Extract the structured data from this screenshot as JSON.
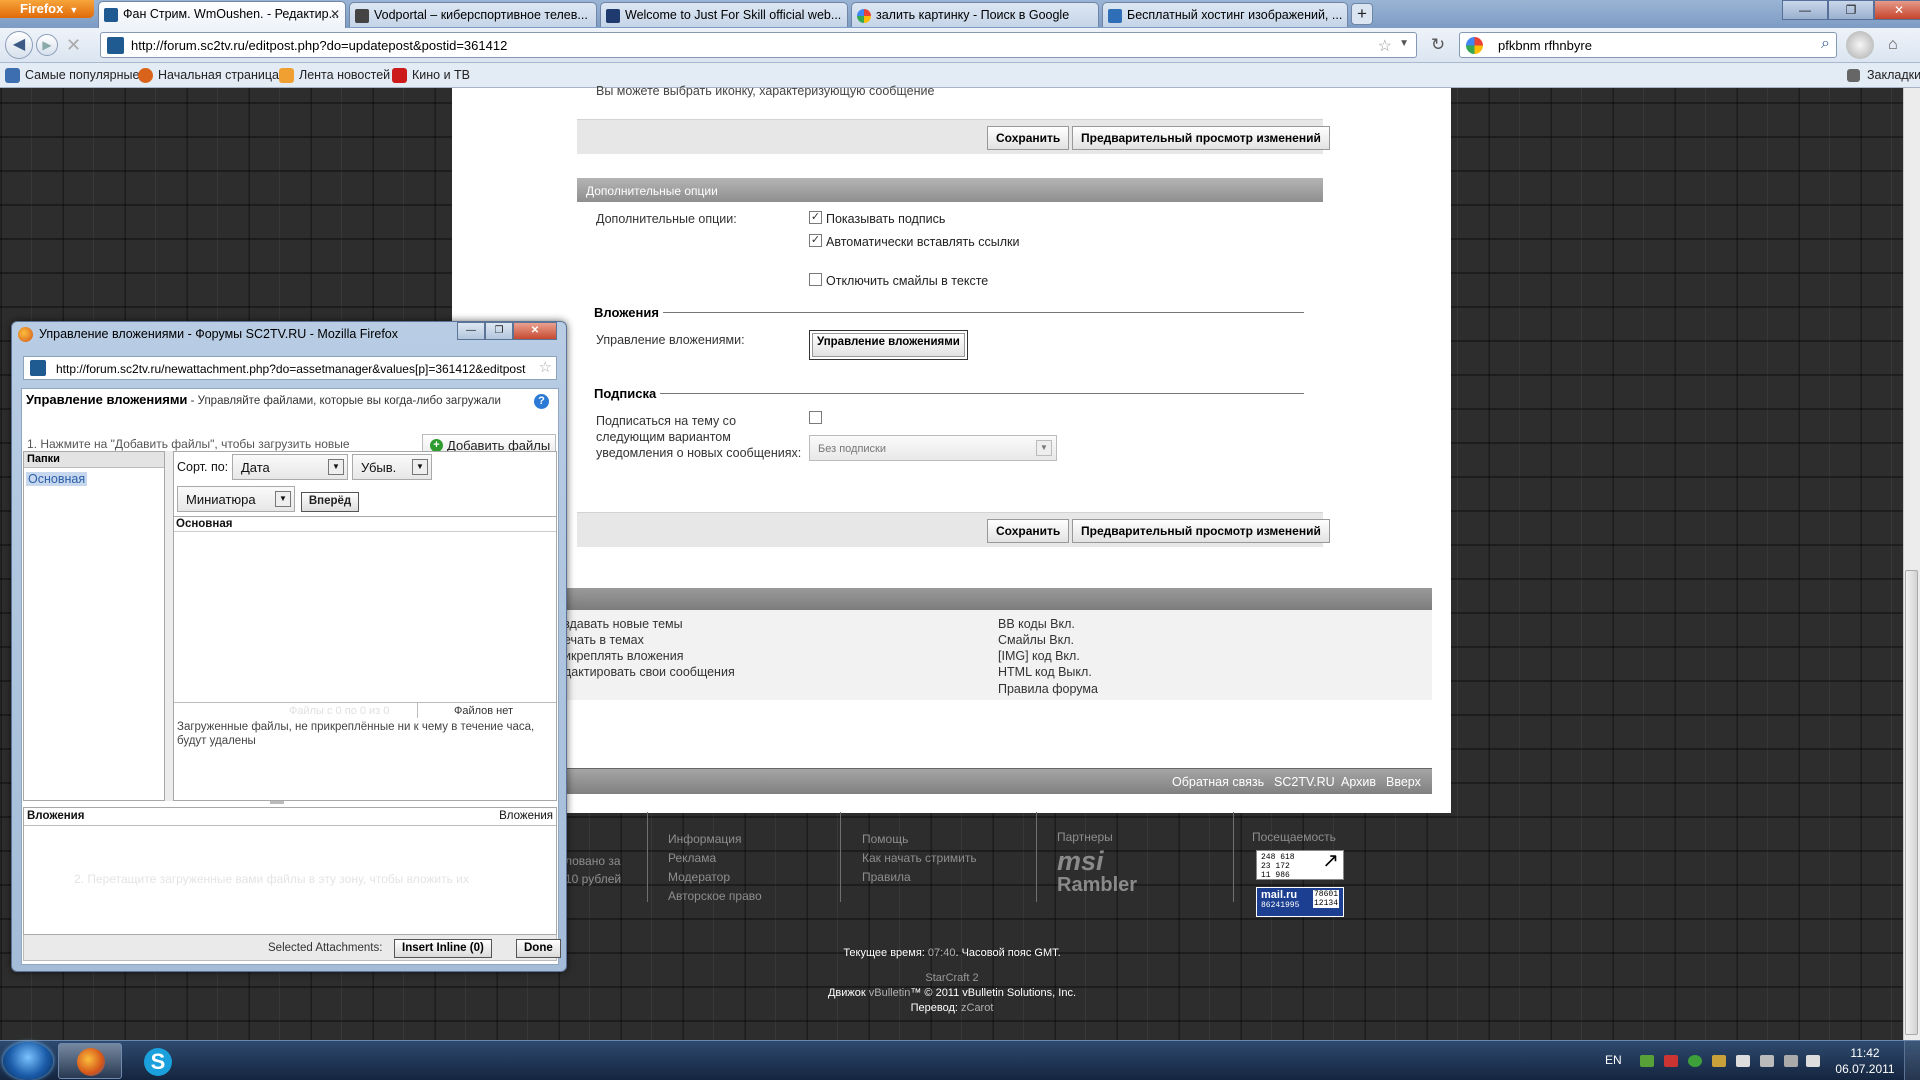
{
  "browser": {
    "menu_label": "Firefox",
    "tabs": [
      {
        "label": "Фан Стрим. WmOushen. - Редактир...",
        "active": true,
        "icon_color": "#1f5a91"
      },
      {
        "label": "Vodportal – киберспортивное телев...",
        "active": false,
        "icon_color": "#444444"
      },
      {
        "label": "Welcome to Just For Skill official web...",
        "active": false,
        "icon_color": "#1e3a6e"
      },
      {
        "label": "залить картинку - Поиск в Google",
        "active": false,
        "icon_color": "#4285f4"
      },
      {
        "label": "Бесплатный хостинг изображений, ...",
        "active": false,
        "icon_color": "#2f6fb8"
      }
    ],
    "url": "http://forum.sc2tv.ru/editpost.php?do=updatepost&postid=361412",
    "search_value": "pfkbnm rfhnbyre",
    "bookmarks": [
      {
        "label": "Самые популярные",
        "icon_color": "#3d6fb0"
      },
      {
        "label": "Начальная страница",
        "icon_color": "#d9631a"
      },
      {
        "label": "Лента новостей",
        "icon_color": "#f0a030"
      },
      {
        "label": "Кино и ТВ",
        "icon_color": "#cc1a1a"
      }
    ],
    "bookmarks_menu": "Закладки"
  },
  "forum": {
    "icon_hint": "Вы можете выбрать иконку, характеризующую сообщение",
    "save_label": "Сохранить",
    "preview_label": "Предварительный просмотр изменений",
    "extra_options_header": "Дополнительные опции",
    "extra_options_label": "Дополнительные опции:",
    "opt_signature": "Показывать подпись",
    "opt_autolinks": "Автоматически вставлять ссылки",
    "opt_smilies": "Отключить смайлы в тексте",
    "attachments_legend": "Вложения",
    "attachments_label": "Управление вложениями:",
    "manage_attachments_btn": "Управление вложениями",
    "subscription_legend": "Подписка",
    "subscribe_label_1": "Подписаться на тему со",
    "subscribe_label_2": "следующим вариантом",
    "subscribe_label_3": "уведомления о новых сообщениях:",
    "subscribe_select": "Без подписки",
    "permissions_left": [
      "здавать новые темы",
      "ечать в темах",
      "икреплять вложения",
      "дактировать свои сообщения"
    ],
    "permissions_right": [
      "BB коды Вкл.",
      "Смайлы Вкл.",
      "[IMG] код Вкл.",
      "HTML код Выкл."
    ],
    "forum_rules": "Правила форума",
    "footer_links": [
      "Обратная связь",
      "SC2TV.RU",
      "Архив",
      "Вверх"
    ]
  },
  "page_footer": {
    "col_faded_1": [
      "ловано за",
      "10 рублей"
    ],
    "col_info": [
      "Информация",
      "Реклама",
      "Модератор",
      "Авторское право"
    ],
    "col_help": [
      "Помощь",
      "Как начать стримить",
      "Правила"
    ],
    "partners_heading": "Партнеры",
    "partner_logos": [
      "msi",
      "Rambler"
    ],
    "visits_heading": "Посещаемость",
    "counter_1": [
      "248 618",
      "23 172",
      "11 986"
    ],
    "counter_2_brand": "mail.ru",
    "counter_2_values": [
      "86241995",
      "78601",
      "12134"
    ],
    "time_prefix": "Текущее время:",
    "time_value": "07:40",
    "time_suffix": ". Часовой пояс GMT.",
    "site_name": "StarCraft 2",
    "engine_prefix": "Движок",
    "engine_name": "vBulletin",
    "engine_suffix": "™ © 2011 vBulletin Solutions, Inc.",
    "translation_prefix": "Перевод:",
    "translation_name": "zCarot"
  },
  "popup": {
    "title": "Управление вложениями - Форумы SC2TV.RU - Mozilla Firefox",
    "url": "http://forum.sc2tv.ru/newattachment.php?do=assetmanager&values[p]=361412&editpost",
    "heading": "Управление вложениями",
    "heading_desc": "- Управляйте файлами, которые вы когда-либо загружали",
    "step1": "1. Нажмите на \"Добавить файлы\", чтобы загрузить новые",
    "add_files_btn": "Добавить файлы",
    "folders_header": "Папки",
    "folders_overlap": "Файлы",
    "folder_item": "Основная",
    "sort_label": "Сорт. по:",
    "sort_value": "Дата",
    "order_value": "Убыв.",
    "view_value": "Миниатюра",
    "go_btn": "Вперёд",
    "files_header": "Основная",
    "files_range": "Файлы с 0 по 0 из 0",
    "files_none": "Файлов нет",
    "files_note": "Загруженные файлы, не прикреплённые ни к чему в течение часа, будут удалены",
    "attachments_header": "Вложения",
    "attachments_header_right": "Вложения",
    "step2": "2. Перетащите загруженные вами файлы в эту зону, чтобы вложить их",
    "selected_label": "Selected Attachments:",
    "insert_inline": "Insert Inline (0)",
    "done_btn": "Done"
  },
  "taskbar": {
    "language": "EN",
    "time": "11:42",
    "date": "06.07.2011"
  },
  "colors": {
    "forum_header_gray": "#8f8f8f",
    "taskbar_bg": "#14253f",
    "link_blue": "#2b5fa8"
  }
}
